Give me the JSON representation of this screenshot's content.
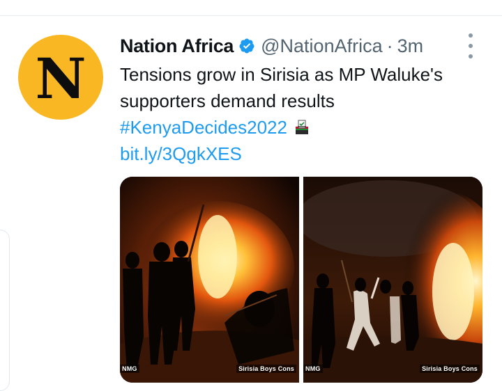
{
  "tweet": {
    "author": {
      "name": "Nation Africa",
      "handle": "@NationAfrica",
      "avatar_letter": "N",
      "avatar_color": "#f9b823"
    },
    "separator": "·",
    "time": "3m",
    "text_line1": "Tensions grow in Sirisia as MP Waluke's",
    "text_line2": "supporters demand results",
    "hashtag": "#KenyaDecides2022",
    "hashflag_icon": "ballot-box-icon",
    "link": "bit.ly/3QgkXES",
    "media": [
      {
        "caption_left": "NMG",
        "caption_right": "Sirisia Boys Cons"
      },
      {
        "caption_left": "NMG",
        "caption_right": "Sirisia Boys Cons"
      }
    ]
  },
  "colors": {
    "link": "#1d9bf0",
    "verified": "#1d9bf0",
    "secondary_text": "#536471"
  }
}
